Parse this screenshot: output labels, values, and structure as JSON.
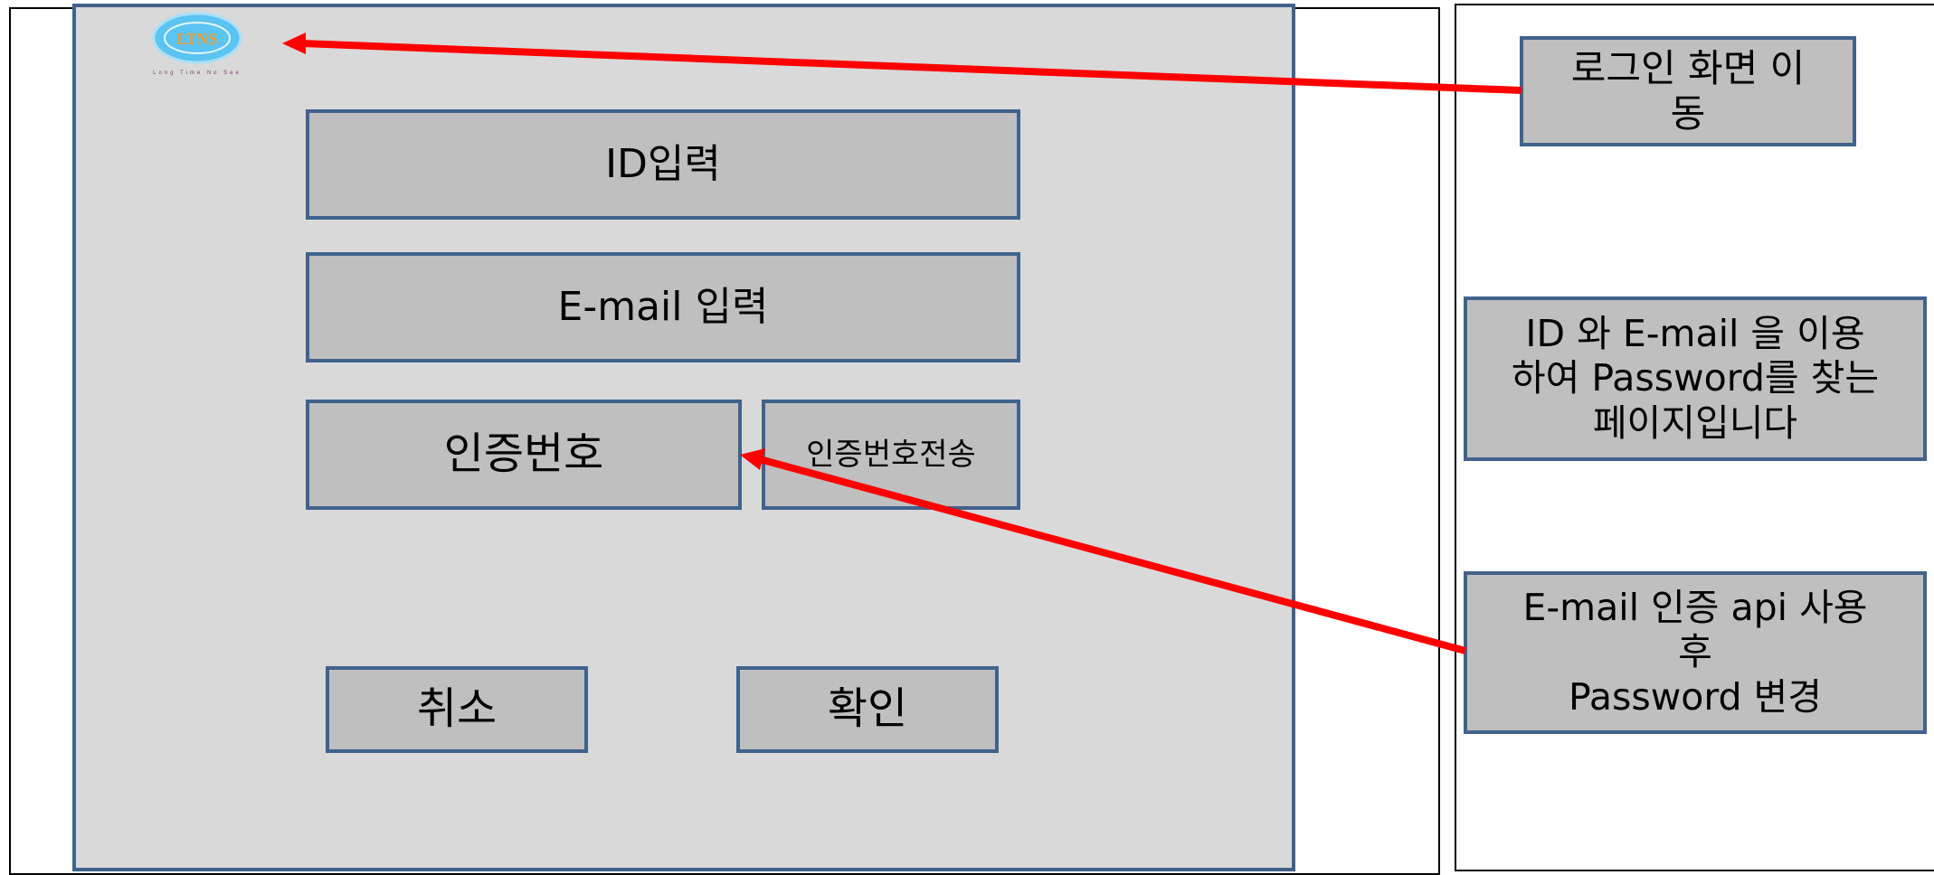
{
  "logo": {
    "text": "LTNS",
    "caption": "Long Time No See"
  },
  "form": {
    "id_field": "ID입력",
    "email_field": "E-mail 입력",
    "auth_code_field": "인증번호",
    "send_code_button": "인증번호전송",
    "cancel_button": "취소",
    "confirm_button": "확인"
  },
  "annotations": {
    "login_nav": "로그인 화면 이\n동",
    "page_description": "ID 와 E-mail 을 이용\n하여 Password를 찾는\n페이지입니다",
    "email_auth": "E-mail 인증 api 사용\n후\nPassword 변경"
  },
  "colors": {
    "screen_bg": "#d9d9d9",
    "box_fill": "#bfbfbf",
    "box_border": "#41628c",
    "arrow": "#ff0000"
  }
}
